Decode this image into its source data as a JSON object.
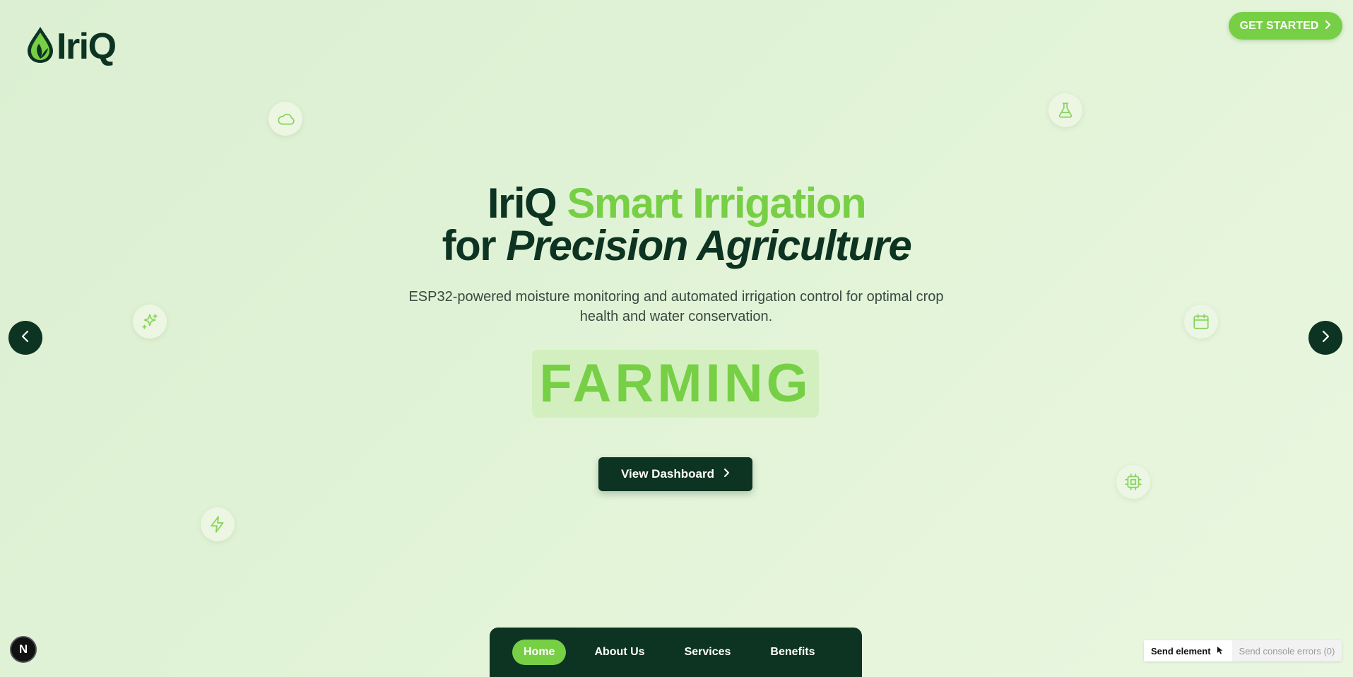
{
  "brand": {
    "name": "IriQ"
  },
  "header": {
    "cta_label": "GET STARTED"
  },
  "hero": {
    "title_part1": "IriQ",
    "title_part2": "Smart Irrigation",
    "title_part3": "for",
    "title_part4": "Precision Agriculture",
    "subtitle": "ESP32-powered moisture monitoring and automated irrigation control for optimal crop health and water conservation.",
    "rotating_word": "FARMING",
    "cta_label": "View Dashboard"
  },
  "floating_icons": [
    "cloud-icon",
    "flask-icon",
    "sparkles-icon",
    "calendar-icon",
    "cpu-icon",
    "zap-icon"
  ],
  "carousel": {
    "prev_icon": "chevron-left-icon",
    "next_icon": "chevron-right-icon"
  },
  "bottom_nav": {
    "items": [
      {
        "label": "Home",
        "active": true
      },
      {
        "label": "About Us",
        "active": false
      },
      {
        "label": "Services",
        "active": false
      },
      {
        "label": "Benefits",
        "active": false
      }
    ]
  },
  "dev_overlay": {
    "badge": "N",
    "send_element": "Send element",
    "send_console": "Send console errors (0)"
  },
  "colors": {
    "primary_dark": "#0d3322",
    "accent_green": "#77cf45",
    "background": "#e1f3d6"
  }
}
